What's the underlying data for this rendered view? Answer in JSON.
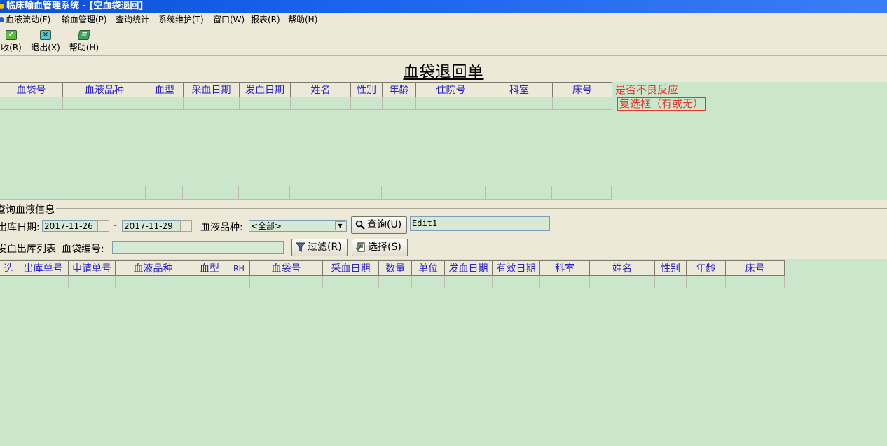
{
  "window": {
    "title": "临床输血管理系统 - [空血袋退回]"
  },
  "menu": [
    "血液流动(F)",
    "输血管理(P)",
    "查询统计",
    "系统维护(T)",
    "窗口(W)",
    "报表(R)",
    "帮助(H)"
  ],
  "toolbar": {
    "receive_label": "收(R)",
    "exit_label": "退出(X)",
    "help_label": "帮助(H)"
  },
  "form": {
    "title": "血袋退回单"
  },
  "return_grid": {
    "columns": [
      "血袋号",
      "血液品种",
      "血型",
      "采血日期",
      "发血日期",
      "姓名",
      "性别",
      "年龄",
      "住院号",
      "科室",
      "床号"
    ]
  },
  "annotation": {
    "line1": "是否不良反应",
    "line2": "复选框（有或无）"
  },
  "query": {
    "group_title": "查询血液信息",
    "out_date_label": "出库日期:",
    "date_from": "2017-11-26",
    "date_sep": "-",
    "date_to": "2017-11-29",
    "blood_type_label": "血液品种:",
    "blood_type_value": "<全部>",
    "search_button": "查询(U)",
    "edit_value": "Edit1",
    "list_label": "发血出库列表",
    "bag_no_label": "血袋编号:",
    "bag_no_value": "",
    "filter_button": "过滤(R)",
    "select_button": "选择(S)"
  },
  "out_grid": {
    "columns": [
      "选",
      "出库单号",
      "申请单号",
      "血液品种",
      "血型",
      "RH",
      "血袋号",
      "采血日期",
      "数量",
      "单位",
      "发血日期",
      "有效日期",
      "科室",
      "姓名",
      "性别",
      "年龄",
      "床号"
    ]
  }
}
